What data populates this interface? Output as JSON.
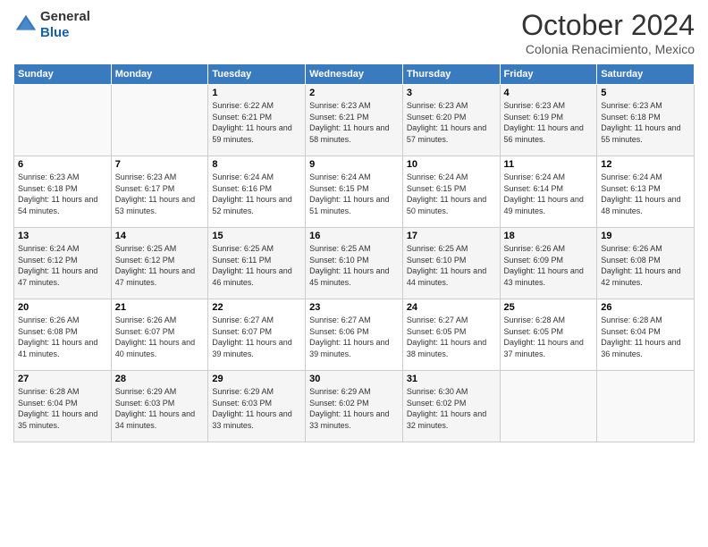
{
  "header": {
    "logo": {
      "line1": "General",
      "line2": "Blue"
    },
    "title": "October 2024",
    "subtitle": "Colonia Renacimiento, Mexico"
  },
  "weekdays": [
    "Sunday",
    "Monday",
    "Tuesday",
    "Wednesday",
    "Thursday",
    "Friday",
    "Saturday"
  ],
  "weeks": [
    [
      {
        "day": "",
        "sunrise": "",
        "sunset": "",
        "daylight": ""
      },
      {
        "day": "",
        "sunrise": "",
        "sunset": "",
        "daylight": ""
      },
      {
        "day": "1",
        "sunrise": "Sunrise: 6:22 AM",
        "sunset": "Sunset: 6:21 PM",
        "daylight": "Daylight: 11 hours and 59 minutes."
      },
      {
        "day": "2",
        "sunrise": "Sunrise: 6:23 AM",
        "sunset": "Sunset: 6:21 PM",
        "daylight": "Daylight: 11 hours and 58 minutes."
      },
      {
        "day": "3",
        "sunrise": "Sunrise: 6:23 AM",
        "sunset": "Sunset: 6:20 PM",
        "daylight": "Daylight: 11 hours and 57 minutes."
      },
      {
        "day": "4",
        "sunrise": "Sunrise: 6:23 AM",
        "sunset": "Sunset: 6:19 PM",
        "daylight": "Daylight: 11 hours and 56 minutes."
      },
      {
        "day": "5",
        "sunrise": "Sunrise: 6:23 AM",
        "sunset": "Sunset: 6:18 PM",
        "daylight": "Daylight: 11 hours and 55 minutes."
      }
    ],
    [
      {
        "day": "6",
        "sunrise": "Sunrise: 6:23 AM",
        "sunset": "Sunset: 6:18 PM",
        "daylight": "Daylight: 11 hours and 54 minutes."
      },
      {
        "day": "7",
        "sunrise": "Sunrise: 6:23 AM",
        "sunset": "Sunset: 6:17 PM",
        "daylight": "Daylight: 11 hours and 53 minutes."
      },
      {
        "day": "8",
        "sunrise": "Sunrise: 6:24 AM",
        "sunset": "Sunset: 6:16 PM",
        "daylight": "Daylight: 11 hours and 52 minutes."
      },
      {
        "day": "9",
        "sunrise": "Sunrise: 6:24 AM",
        "sunset": "Sunset: 6:15 PM",
        "daylight": "Daylight: 11 hours and 51 minutes."
      },
      {
        "day": "10",
        "sunrise": "Sunrise: 6:24 AM",
        "sunset": "Sunset: 6:15 PM",
        "daylight": "Daylight: 11 hours and 50 minutes."
      },
      {
        "day": "11",
        "sunrise": "Sunrise: 6:24 AM",
        "sunset": "Sunset: 6:14 PM",
        "daylight": "Daylight: 11 hours and 49 minutes."
      },
      {
        "day": "12",
        "sunrise": "Sunrise: 6:24 AM",
        "sunset": "Sunset: 6:13 PM",
        "daylight": "Daylight: 11 hours and 48 minutes."
      }
    ],
    [
      {
        "day": "13",
        "sunrise": "Sunrise: 6:24 AM",
        "sunset": "Sunset: 6:12 PM",
        "daylight": "Daylight: 11 hours and 47 minutes."
      },
      {
        "day": "14",
        "sunrise": "Sunrise: 6:25 AM",
        "sunset": "Sunset: 6:12 PM",
        "daylight": "Daylight: 11 hours and 47 minutes."
      },
      {
        "day": "15",
        "sunrise": "Sunrise: 6:25 AM",
        "sunset": "Sunset: 6:11 PM",
        "daylight": "Daylight: 11 hours and 46 minutes."
      },
      {
        "day": "16",
        "sunrise": "Sunrise: 6:25 AM",
        "sunset": "Sunset: 6:10 PM",
        "daylight": "Daylight: 11 hours and 45 minutes."
      },
      {
        "day": "17",
        "sunrise": "Sunrise: 6:25 AM",
        "sunset": "Sunset: 6:10 PM",
        "daylight": "Daylight: 11 hours and 44 minutes."
      },
      {
        "day": "18",
        "sunrise": "Sunrise: 6:26 AM",
        "sunset": "Sunset: 6:09 PM",
        "daylight": "Daylight: 11 hours and 43 minutes."
      },
      {
        "day": "19",
        "sunrise": "Sunrise: 6:26 AM",
        "sunset": "Sunset: 6:08 PM",
        "daylight": "Daylight: 11 hours and 42 minutes."
      }
    ],
    [
      {
        "day": "20",
        "sunrise": "Sunrise: 6:26 AM",
        "sunset": "Sunset: 6:08 PM",
        "daylight": "Daylight: 11 hours and 41 minutes."
      },
      {
        "day": "21",
        "sunrise": "Sunrise: 6:26 AM",
        "sunset": "Sunset: 6:07 PM",
        "daylight": "Daylight: 11 hours and 40 minutes."
      },
      {
        "day": "22",
        "sunrise": "Sunrise: 6:27 AM",
        "sunset": "Sunset: 6:07 PM",
        "daylight": "Daylight: 11 hours and 39 minutes."
      },
      {
        "day": "23",
        "sunrise": "Sunrise: 6:27 AM",
        "sunset": "Sunset: 6:06 PM",
        "daylight": "Daylight: 11 hours and 39 minutes."
      },
      {
        "day": "24",
        "sunrise": "Sunrise: 6:27 AM",
        "sunset": "Sunset: 6:05 PM",
        "daylight": "Daylight: 11 hours and 38 minutes."
      },
      {
        "day": "25",
        "sunrise": "Sunrise: 6:28 AM",
        "sunset": "Sunset: 6:05 PM",
        "daylight": "Daylight: 11 hours and 37 minutes."
      },
      {
        "day": "26",
        "sunrise": "Sunrise: 6:28 AM",
        "sunset": "Sunset: 6:04 PM",
        "daylight": "Daylight: 11 hours and 36 minutes."
      }
    ],
    [
      {
        "day": "27",
        "sunrise": "Sunrise: 6:28 AM",
        "sunset": "Sunset: 6:04 PM",
        "daylight": "Daylight: 11 hours and 35 minutes."
      },
      {
        "day": "28",
        "sunrise": "Sunrise: 6:29 AM",
        "sunset": "Sunset: 6:03 PM",
        "daylight": "Daylight: 11 hours and 34 minutes."
      },
      {
        "day": "29",
        "sunrise": "Sunrise: 6:29 AM",
        "sunset": "Sunset: 6:03 PM",
        "daylight": "Daylight: 11 hours and 33 minutes."
      },
      {
        "day": "30",
        "sunrise": "Sunrise: 6:29 AM",
        "sunset": "Sunset: 6:02 PM",
        "daylight": "Daylight: 11 hours and 33 minutes."
      },
      {
        "day": "31",
        "sunrise": "Sunrise: 6:30 AM",
        "sunset": "Sunset: 6:02 PM",
        "daylight": "Daylight: 11 hours and 32 minutes."
      },
      {
        "day": "",
        "sunrise": "",
        "sunset": "",
        "daylight": ""
      },
      {
        "day": "",
        "sunrise": "",
        "sunset": "",
        "daylight": ""
      }
    ]
  ]
}
